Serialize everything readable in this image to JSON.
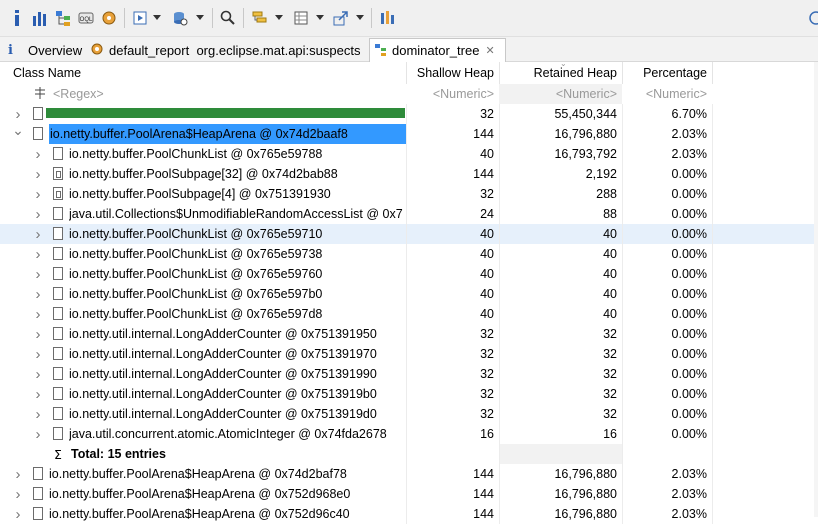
{
  "toolbar": {
    "icons": [
      "info-icon",
      "histogram-icon",
      "dominator-tree-icon",
      "oql-icon",
      "heap-dump-overview-icon",
      "run-report-icon",
      "query-browser-icon",
      "search-icon",
      "group-by-icon",
      "calculate-retained-icon",
      "export-icon",
      "pin-icon"
    ]
  },
  "tabs": [
    {
      "label": "Overview",
      "icon": "info-icon"
    },
    {
      "label": "default_report  org.eclipse.mat.api:suspects",
      "icon": "report-icon"
    },
    {
      "label": "dominator_tree",
      "icon": "dominator-tree-icon",
      "active": true
    }
  ],
  "columns": {
    "class_name": "Class Name",
    "shallow_heap": "Shallow Heap",
    "retained_heap": "Retained Heap",
    "percentage": "Percentage"
  },
  "filter_row": {
    "class_name": "<Regex>",
    "shallow_heap": "<Numeric>",
    "retained_heap": "<Numeric>",
    "percentage": "<Numeric>"
  },
  "rows": [
    {
      "name": "",
      "shallow": "32",
      "retained": "55,450,344",
      "pct": "6.70%",
      "level": 0,
      "chevron": "right",
      "redacted": true
    },
    {
      "name": "io.netty.buffer.PoolArena$HeapArena @ 0x74d2baaf8",
      "shallow": "144",
      "retained": "16,796,880",
      "pct": "2.03%",
      "level": 0,
      "chevron": "down",
      "highlight": true
    },
    {
      "name": "io.netty.buffer.PoolChunkList @ 0x765e59788",
      "shallow": "40",
      "retained": "16,793,792",
      "pct": "2.03%",
      "level": 1,
      "chevron": "right"
    },
    {
      "name": "io.netty.buffer.PoolSubpage[32] @ 0x74d2bab88",
      "shallow": "144",
      "retained": "2,192",
      "pct": "0.00%",
      "level": 1,
      "chevron": "right",
      "array": true
    },
    {
      "name": "io.netty.buffer.PoolSubpage[4] @ 0x751391930",
      "shallow": "32",
      "retained": "288",
      "pct": "0.00%",
      "level": 1,
      "chevron": "right",
      "array": true
    },
    {
      "name": "java.util.Collections$UnmodifiableRandomAccessList @ 0x7",
      "shallow": "24",
      "retained": "88",
      "pct": "0.00%",
      "level": 1,
      "chevron": "right"
    },
    {
      "name": "io.netty.buffer.PoolChunkList @ 0x765e59710",
      "shallow": "40",
      "retained": "40",
      "pct": "0.00%",
      "level": 1,
      "chevron": "right",
      "selected": true
    },
    {
      "name": "io.netty.buffer.PoolChunkList @ 0x765e59738",
      "shallow": "40",
      "retained": "40",
      "pct": "0.00%",
      "level": 1,
      "chevron": "right"
    },
    {
      "name": "io.netty.buffer.PoolChunkList @ 0x765e59760",
      "shallow": "40",
      "retained": "40",
      "pct": "0.00%",
      "level": 1,
      "chevron": "right"
    },
    {
      "name": "io.netty.buffer.PoolChunkList @ 0x765e597b0",
      "shallow": "40",
      "retained": "40",
      "pct": "0.00%",
      "level": 1,
      "chevron": "right"
    },
    {
      "name": "io.netty.buffer.PoolChunkList @ 0x765e597d8",
      "shallow": "40",
      "retained": "40",
      "pct": "0.00%",
      "level": 1,
      "chevron": "right"
    },
    {
      "name": "io.netty.util.internal.LongAdderCounter @ 0x751391950",
      "shallow": "32",
      "retained": "32",
      "pct": "0.00%",
      "level": 1,
      "chevron": "right"
    },
    {
      "name": "io.netty.util.internal.LongAdderCounter @ 0x751391970",
      "shallow": "32",
      "retained": "32",
      "pct": "0.00%",
      "level": 1,
      "chevron": "right"
    },
    {
      "name": "io.netty.util.internal.LongAdderCounter @ 0x751391990",
      "shallow": "32",
      "retained": "32",
      "pct": "0.00%",
      "level": 1,
      "chevron": "right"
    },
    {
      "name": "io.netty.util.internal.LongAdderCounter @ 0x7513919b0",
      "shallow": "32",
      "retained": "32",
      "pct": "0.00%",
      "level": 1,
      "chevron": "right"
    },
    {
      "name": "io.netty.util.internal.LongAdderCounter @ 0x7513919d0",
      "shallow": "32",
      "retained": "32",
      "pct": "0.00%",
      "level": 1,
      "chevron": "right"
    },
    {
      "name": "java.util.concurrent.atomic.AtomicInteger @ 0x74fda2678",
      "shallow": "16",
      "retained": "16",
      "pct": "0.00%",
      "level": 1,
      "chevron": "right"
    },
    {
      "name": "Total: 15 entries",
      "shallow": "",
      "retained": "",
      "pct": "",
      "level": 1,
      "total": true
    },
    {
      "name": "io.netty.buffer.PoolArena$HeapArena @ 0x74d2baf78",
      "shallow": "144",
      "retained": "16,796,880",
      "pct": "2.03%",
      "level": 0,
      "chevron": "right"
    },
    {
      "name": "io.netty.buffer.PoolArena$HeapArena @ 0x752d968e0",
      "shallow": "144",
      "retained": "16,796,880",
      "pct": "2.03%",
      "level": 0,
      "chevron": "right"
    },
    {
      "name": "io.netty.buffer.PoolArena$HeapArena @ 0x752d96c40",
      "shallow": "144",
      "retained": "16,796,880",
      "pct": "2.03%",
      "level": 0,
      "chevron": "right"
    }
  ],
  "colors": {
    "highlight": "#3399ff",
    "selected": "#e6f0fb",
    "redaction": "#2e8b3a",
    "retained_bg": "#f2f2f2"
  }
}
